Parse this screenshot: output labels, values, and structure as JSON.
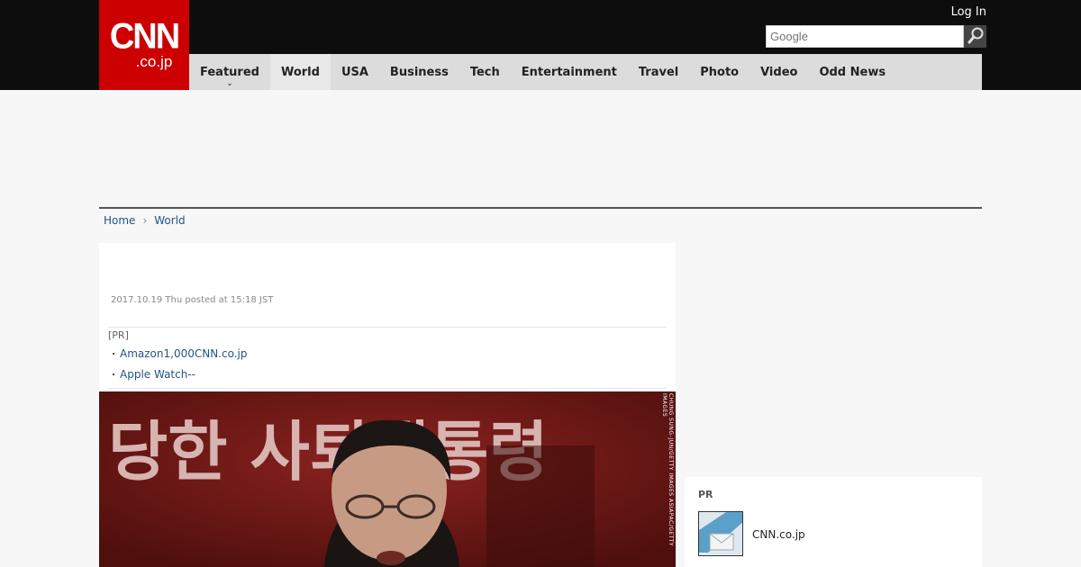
{
  "header": {
    "logo_main": "CNN",
    "logo_sub": ".co.jp",
    "login_label": "Log In",
    "search_placeholder": "Google",
    "search_icon": "magnifier-icon"
  },
  "nav": {
    "items": [
      {
        "label": "Featured",
        "has_dropdown": true
      },
      {
        "label": "World",
        "active": true
      },
      {
        "label": "USA"
      },
      {
        "label": "Business"
      },
      {
        "label": "Tech"
      },
      {
        "label": "Entertainment"
      },
      {
        "label": "Travel"
      },
      {
        "label": "Photo"
      },
      {
        "label": "Video"
      },
      {
        "label": "Odd News"
      }
    ],
    "dropdown_glyph": "⌄"
  },
  "breadcrumb": {
    "home": "Home",
    "separator": "›",
    "current": "World"
  },
  "article": {
    "posted": "2017.10.19 Thu posted at 15:18 JST",
    "pr_label": "[PR]",
    "pr_links": [
      "Amazon1,000CNN.co.jp",
      "Apple Watch--"
    ],
    "bullet": "・",
    "photo_banner_text": "당한 사퇴대통령",
    "photo_credit": "CHUNG SUNG-JUN/GETTY IMAGES ASIAPAC/GETTY IMAGES"
  },
  "sidebar": {
    "pr_label": "PR",
    "pr_item_title": "CNN.co.jp"
  },
  "colors": {
    "brand_red": "#cc0000",
    "topbar": "#0d0d0d",
    "nav_bg": "#dcdcdc",
    "link": "#225588"
  }
}
